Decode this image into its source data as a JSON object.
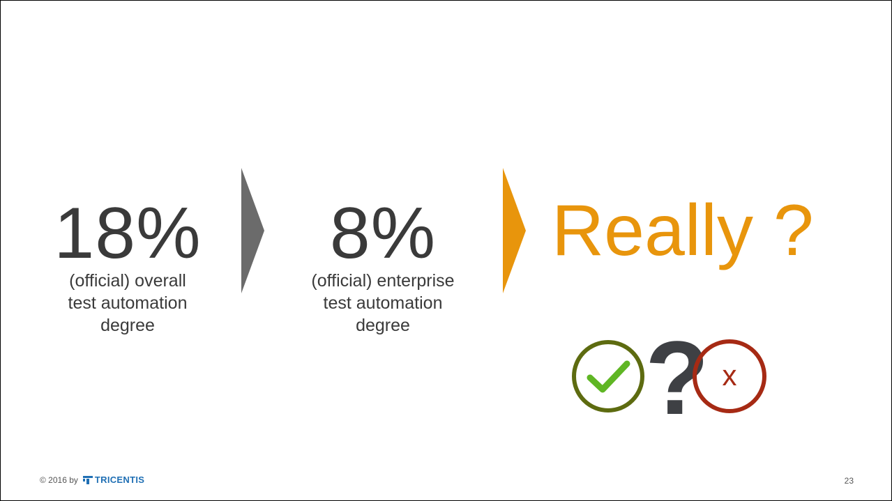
{
  "slide": {
    "stat1": {
      "value": "18%",
      "caption_lines": [
        "(official) overall",
        "test automation",
        "degree"
      ]
    },
    "stat2": {
      "value": "8%",
      "caption_lines": [
        "(official) enterprise",
        "test automation",
        "degree"
      ]
    },
    "headline": "Really ?",
    "question_mark": "?",
    "x_mark": "x"
  },
  "footer": {
    "copyright": "© 2016 by",
    "logo_text": "TRICENTIS",
    "page_number": "23"
  },
  "colors": {
    "text": "#3a3a3a",
    "chevron_gray": "#6b6b6b",
    "accent_orange": "#e8950c",
    "check_ring": "#5d6b10",
    "check_mark": "#5fb624",
    "x_ring": "#a62a14",
    "logo_blue": "#1f6fb4"
  },
  "icons": {
    "chevron_1": "chevron-right-icon",
    "chevron_2": "chevron-right-icon",
    "check": "check-circle-icon",
    "x": "x-circle-icon",
    "logo": "tricentis-logo-icon"
  }
}
